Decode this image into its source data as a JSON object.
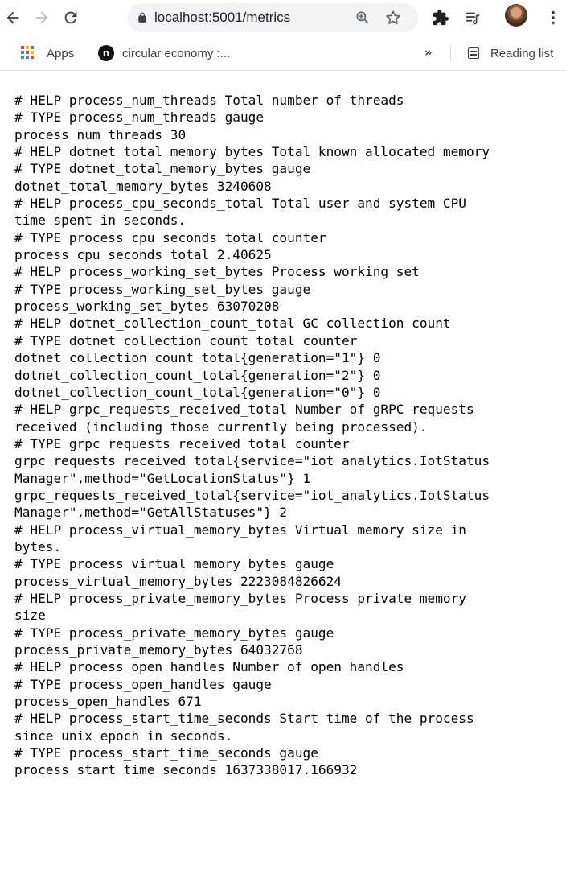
{
  "browser": {
    "url": "localhost:5001/metrics",
    "icons": [
      "back-arrow-icon",
      "forward-arrow-icon",
      "reload-icon",
      "lock-icon",
      "zoom-icon",
      "star-icon",
      "puzzle-extension-icon",
      "reading-list-toolbar-icon",
      "profile-avatar",
      "kebab-menu-icon"
    ]
  },
  "bookmarks": {
    "apps_label": "Apps",
    "notion_label": "circular economy :...",
    "overflow_label": "»",
    "reading_list_label": "Reading list",
    "apps_grid_colors": [
      "#ea4335",
      "#fbbc05",
      "#34a853",
      "#4285f4",
      "#ea4335",
      "#fbbc05",
      "#34a853",
      "#4285f4",
      "#ea4335"
    ]
  },
  "metrics_lines": [
    "# HELP process_num_threads Total number of threads",
    "# TYPE process_num_threads gauge",
    "process_num_threads 30",
    "# HELP dotnet_total_memory_bytes Total known allocated memory",
    "# TYPE dotnet_total_memory_bytes gauge",
    "dotnet_total_memory_bytes 3240608",
    "# HELP process_cpu_seconds_total Total user and system CPU",
    "time spent in seconds.",
    "# TYPE process_cpu_seconds_total counter",
    "process_cpu_seconds_total 2.40625",
    "# HELP process_working_set_bytes Process working set",
    "# TYPE process_working_set_bytes gauge",
    "process_working_set_bytes 63070208",
    "# HELP dotnet_collection_count_total GC collection count",
    "# TYPE dotnet_collection_count_total counter",
    "dotnet_collection_count_total{generation=\"1\"} 0",
    "dotnet_collection_count_total{generation=\"2\"} 0",
    "dotnet_collection_count_total{generation=\"0\"} 0",
    "# HELP grpc_requests_received_total Number of gRPC requests",
    "received (including those currently being processed).",
    "# TYPE grpc_requests_received_total counter",
    "grpc_requests_received_total{service=\"iot_analytics.IotStatus",
    "Manager\",method=\"GetLocationStatus\"} 1",
    "grpc_requests_received_total{service=\"iot_analytics.IotStatus",
    "Manager\",method=\"GetAllStatuses\"} 2",
    "# HELP process_virtual_memory_bytes Virtual memory size in",
    "bytes.",
    "# TYPE process_virtual_memory_bytes gauge",
    "process_virtual_memory_bytes 2223084826624",
    "# HELP process_private_memory_bytes Process private memory",
    "size",
    "# TYPE process_private_memory_bytes gauge",
    "process_private_memory_bytes 64032768",
    "# HELP process_open_handles Number of open handles",
    "# TYPE process_open_handles gauge",
    "process_open_handles 671",
    "# HELP process_start_time_seconds Start time of the process",
    "since unix epoch in seconds.",
    "# TYPE process_start_time_seconds gauge",
    "process_start_time_seconds 1637338017.166932"
  ]
}
